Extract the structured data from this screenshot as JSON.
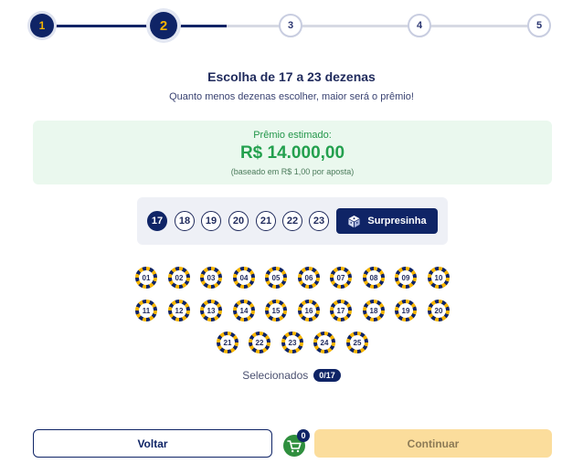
{
  "stepper": {
    "steps": [
      {
        "label": "1",
        "state": "done"
      },
      {
        "label": "2",
        "state": "current"
      },
      {
        "label": "3",
        "state": "todo"
      },
      {
        "label": "4",
        "state": "todo"
      },
      {
        "label": "5",
        "state": "todo"
      }
    ]
  },
  "header": {
    "title": "Escolha de 17 a 23 dezenas",
    "subtitle": "Quanto menos dezenas escolher, maior será o prêmio!"
  },
  "prize": {
    "label": "Prêmio estimado:",
    "value": "R$ 14.000,00",
    "note": "(baseado em R$ 1,00 por aposta)"
  },
  "bet_size": {
    "options": [
      "17",
      "18",
      "19",
      "20",
      "21",
      "22",
      "23"
    ],
    "selected": "17",
    "surprise_label": "Surpresinha",
    "surprise_icon": "dice-icon"
  },
  "numbers": [
    "01",
    "02",
    "03",
    "04",
    "05",
    "06",
    "07",
    "08",
    "09",
    "10",
    "11",
    "12",
    "13",
    "14",
    "15",
    "16",
    "17",
    "18",
    "19",
    "20",
    "21",
    "22",
    "23",
    "24",
    "25"
  ],
  "selection": {
    "label": "Selecionados",
    "count": "0/17"
  },
  "footer": {
    "back_label": "Voltar",
    "cart_count": "0",
    "cart_icon": "cart-icon",
    "continue_label": "Continuar"
  },
  "colors": {
    "navy": "#0f2466",
    "gold": "#f5b400",
    "green": "#23a04e",
    "prize_bg": "#eaf8ee",
    "continue_bg": "#fbdd9c"
  }
}
